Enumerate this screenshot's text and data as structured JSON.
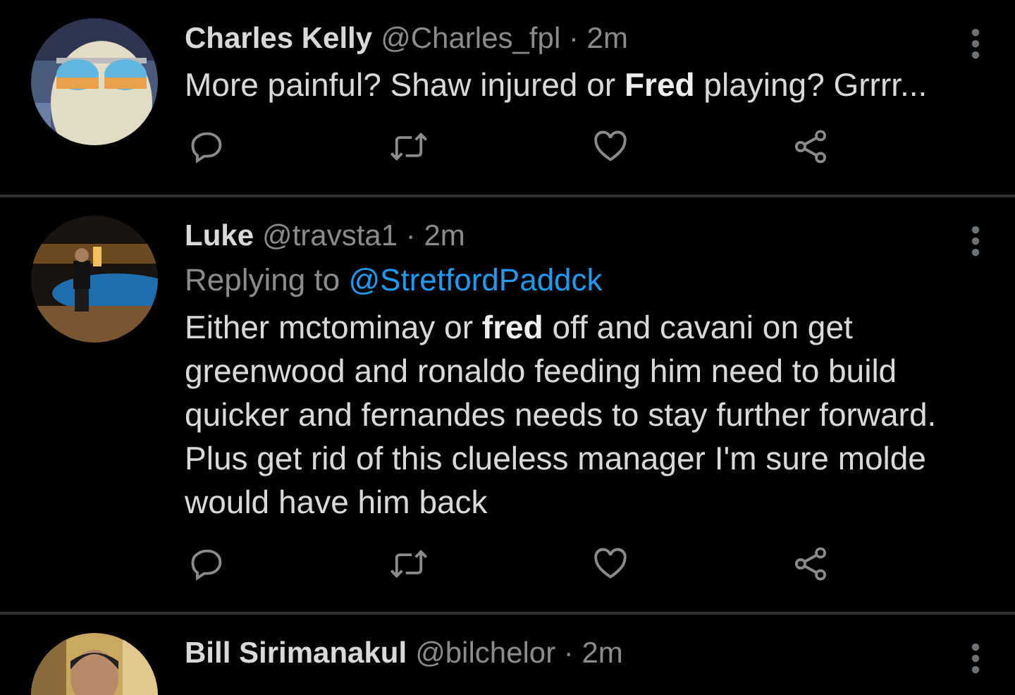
{
  "tweets": [
    {
      "name": "Charles Kelly",
      "meta": "@Charles_fpl · 2m",
      "body": "More painful? Shaw injured or **Fred** playing? Grrrr..."
    },
    {
      "name": "Luke",
      "meta": "@travsta1 · 2m",
      "replying_to": {
        "label": "Replying to",
        "handle": "@StretfordPaddck"
      },
      "body": "Either mctominay or **fred** off and cavani on get greenwood and ronaldo feeding him need to build quicker and fernandes needs to stay further forward. Plus get rid of this clueless manager I'm sure molde would have him back"
    },
    {
      "name": "Bill Sirimanakul",
      "meta": "@bilchelor · 2m"
    }
  ]
}
